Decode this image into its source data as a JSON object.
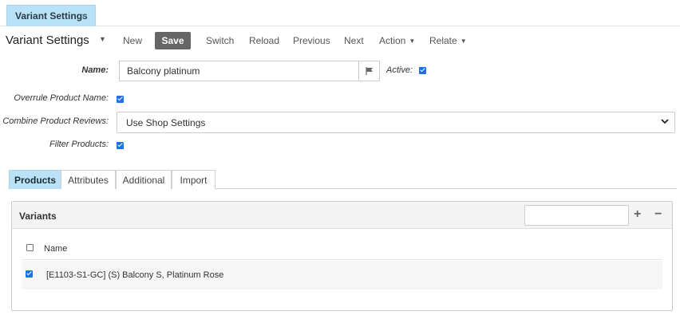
{
  "doc_tab": {
    "label": "Variant Settings",
    "close": "×"
  },
  "toolbar": {
    "title": "Variant Settings",
    "new": "New",
    "save": "Save",
    "switch": "Switch",
    "reload": "Reload",
    "previous": "Previous",
    "next": "Next",
    "action": "Action",
    "relate": "Relate"
  },
  "form": {
    "name_label": "Name:",
    "name_value": "Balcony platinum",
    "active_label": "Active:",
    "active_checked": true,
    "overrule_label": "Overrule Product Name:",
    "overrule_checked": true,
    "combine_label": "Combine Product Reviews:",
    "combine_value": "Use Shop Settings",
    "filter_label": "Filter Products:",
    "filter_checked": true
  },
  "subtabs": [
    {
      "label": "Products",
      "active": true
    },
    {
      "label": "Attributes",
      "active": false
    },
    {
      "label": "Additional",
      "active": false
    },
    {
      "label": "Import",
      "active": false
    }
  ],
  "variants_panel": {
    "title": "Variants",
    "search_value": "",
    "add": "+",
    "remove": "−",
    "column_name": "Name",
    "header_checked": false,
    "rows": [
      {
        "name": "[E1103-S1-GC] (S) Balcony S, Platinum Rose",
        "checked": true
      }
    ]
  },
  "colors": {
    "accent": "#1a73e8",
    "tab_active": "#b9e2f6",
    "save_button": "#666666"
  }
}
